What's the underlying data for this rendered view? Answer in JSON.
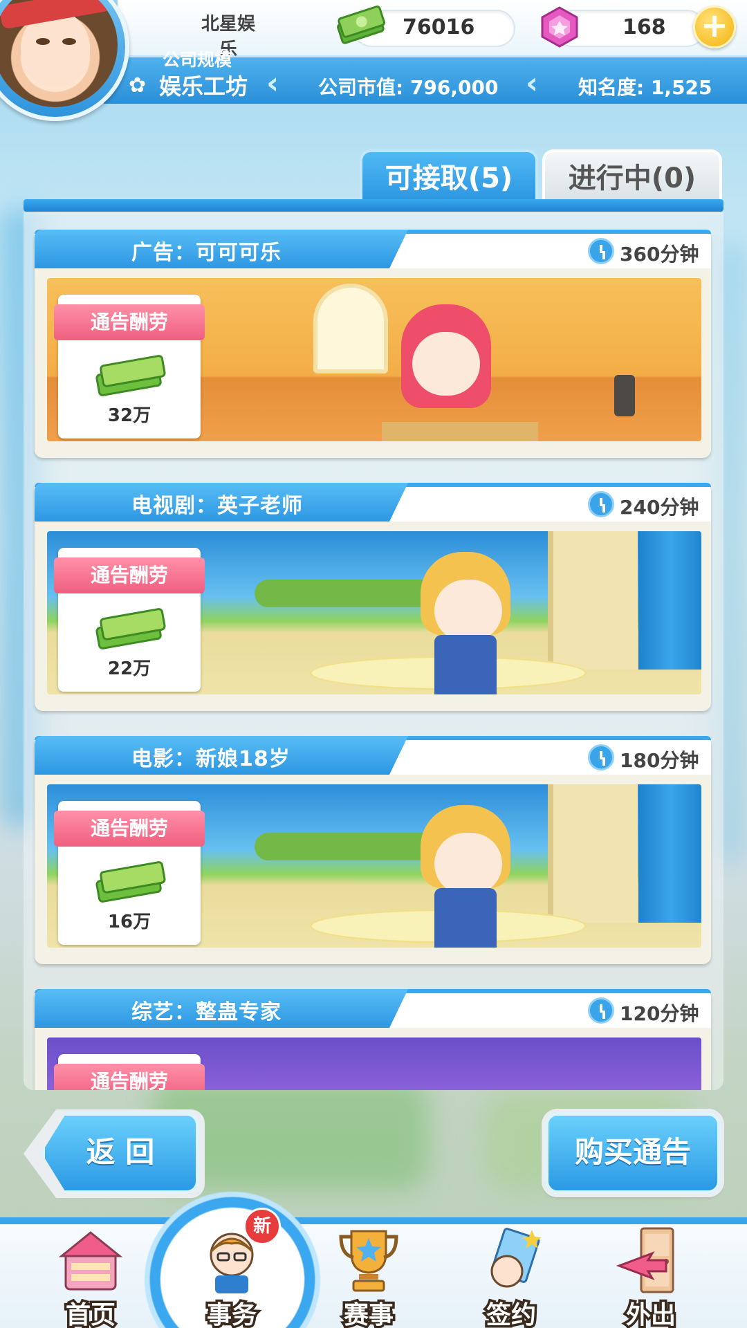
{
  "header": {
    "company_name": "北星娱乐",
    "scale_label": "公司规模",
    "scale_value": "娱乐工坊",
    "market_value": "公司市值: 796,000",
    "fame": "知名度: 1,525",
    "money": "76016",
    "gems": "168"
  },
  "tabs": [
    {
      "label": "可接取(5)",
      "active": true
    },
    {
      "label": "进行中(0)",
      "active": false
    }
  ],
  "jobs": [
    {
      "title": "广告：可可可乐",
      "time": "360分钟",
      "fee_label": "通告酬劳",
      "fee": "32万",
      "scene": "advertisement-studio"
    },
    {
      "title": "电视剧：英子老师",
      "time": "240分钟",
      "fee_label": "通告酬劳",
      "fee": "22万",
      "scene": "castle-stage"
    },
    {
      "title": "电影：新娘18岁",
      "time": "180分钟",
      "fee_label": "通告酬劳",
      "fee": "16万",
      "scene": "castle-stage"
    },
    {
      "title": "综艺：整蛊专家",
      "time": "120分钟",
      "fee_label": "通告酬劳",
      "fee": "",
      "scene": "variety-stage"
    }
  ],
  "buttons": {
    "back": "返 回",
    "buy": "购买通告"
  },
  "nav": {
    "items": [
      {
        "label": "首页",
        "icon": "house-icon"
      },
      {
        "label": "事务",
        "icon": "manager-icon",
        "selected": true,
        "badge": "新"
      },
      {
        "label": "赛事",
        "icon": "trophy-icon"
      },
      {
        "label": "签约",
        "icon": "contract-icon"
      },
      {
        "label": "外出",
        "icon": "door-exit-icon"
      }
    ]
  },
  "colors": {
    "accent": "#2b94e0",
    "fee_label": "#ef5f80",
    "badge": "#e83b3b"
  }
}
